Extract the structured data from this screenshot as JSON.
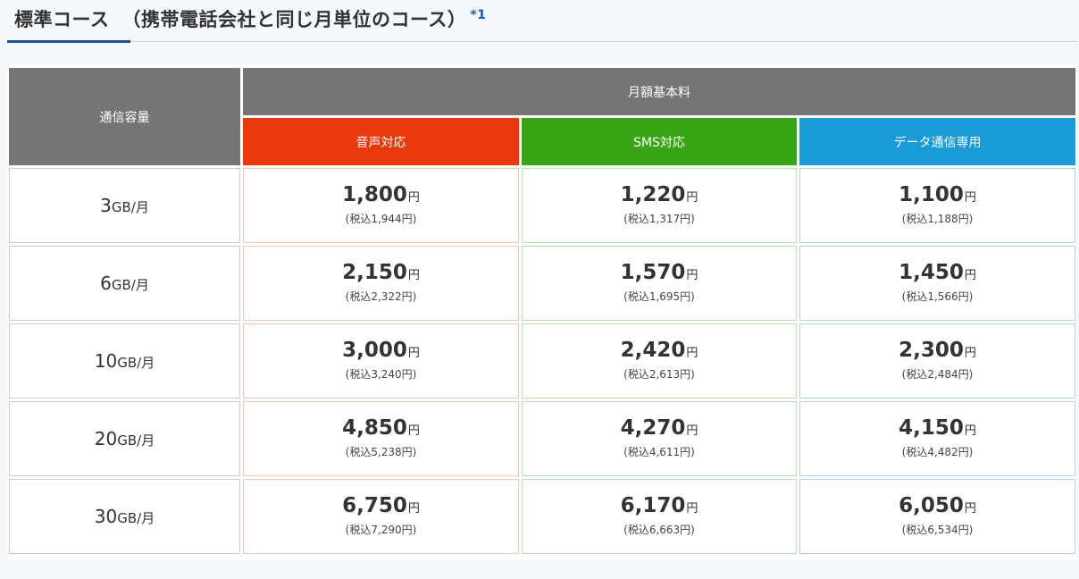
{
  "header": {
    "title": "標準コース",
    "subtitle": "（携帯電話会社と同じ月単位のコース）",
    "footnote_mark": "*1"
  },
  "table": {
    "capacity_header": "通信容量",
    "fee_header": "月額基本料",
    "columns": [
      "音声対応",
      "SMS対応",
      "データ通信専用"
    ],
    "column_colors": [
      "#e8390e",
      "#3aa514",
      "#1a9ad6"
    ],
    "yen": "円",
    "rows": [
      {
        "cap_num": "3",
        "cap_unit": "GB/月",
        "prices": [
          {
            "price": "1,800",
            "tax": "(税込1,944円)"
          },
          {
            "price": "1,220",
            "tax": "(税込1,317円)"
          },
          {
            "price": "1,100",
            "tax": "(税込1,188円)"
          }
        ]
      },
      {
        "cap_num": "6",
        "cap_unit": "GB/月",
        "prices": [
          {
            "price": "2,150",
            "tax": "(税込2,322円)"
          },
          {
            "price": "1,570",
            "tax": "(税込1,695円)"
          },
          {
            "price": "1,450",
            "tax": "(税込1,566円)"
          }
        ]
      },
      {
        "cap_num": "10",
        "cap_unit": "GB/月",
        "prices": [
          {
            "price": "3,000",
            "tax": "(税込3,240円)"
          },
          {
            "price": "2,420",
            "tax": "(税込2,613円)"
          },
          {
            "price": "2,300",
            "tax": "(税込2,484円)"
          }
        ]
      },
      {
        "cap_num": "20",
        "cap_unit": "GB/月",
        "prices": [
          {
            "price": "4,850",
            "tax": "(税込5,238円)"
          },
          {
            "price": "4,270",
            "tax": "(税込4,611円)"
          },
          {
            "price": "4,150",
            "tax": "(税込4,482円)"
          }
        ]
      },
      {
        "cap_num": "30",
        "cap_unit": "GB/月",
        "prices": [
          {
            "price": "6,750",
            "tax": "(税込7,290円)"
          },
          {
            "price": "6,170",
            "tax": "(税込6,663円)"
          },
          {
            "price": "6,050",
            "tax": "(税込6,534円)"
          }
        ]
      }
    ]
  }
}
